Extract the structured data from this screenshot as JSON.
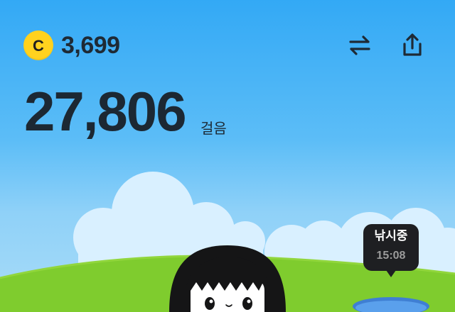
{
  "header": {
    "coin_symbol": "C",
    "coin_balance": "3,699",
    "swap_icon": "swap-arrows-icon",
    "share_icon": "share-icon"
  },
  "steps": {
    "count": "27,806",
    "unit": "걸음"
  },
  "fishing": {
    "status": "낚시중",
    "time": "15:08"
  },
  "colors": {
    "sky_top": "#33a9f5",
    "sky_bottom": "#a9dcf7",
    "coin": "#ffd21e",
    "grass": "#7fcc2e",
    "pond": "#4a8fe0",
    "text_dark": "#1c2833",
    "bubble": "#1e1f22"
  }
}
